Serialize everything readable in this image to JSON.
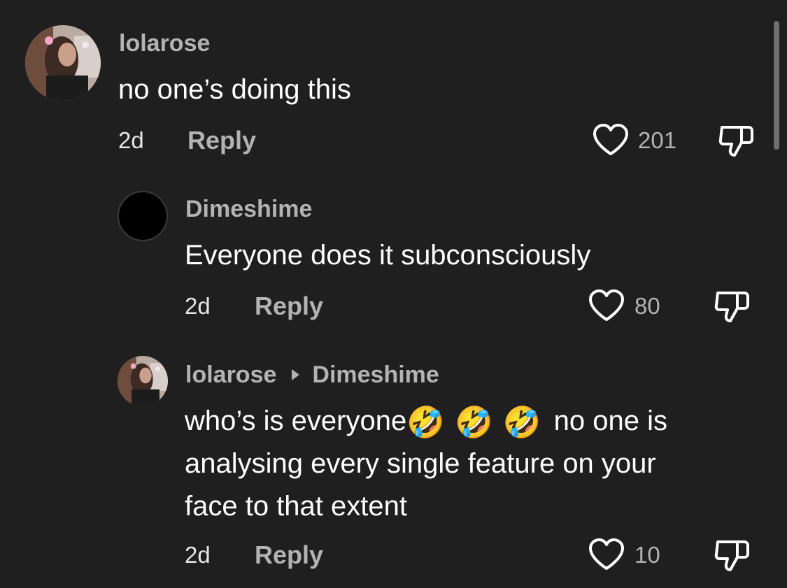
{
  "comments": [
    {
      "username": "lolarose",
      "text": "no one’s doing this",
      "time": "2d",
      "reply_label": "Reply",
      "likes": "201",
      "avatar": "photo-girl-icon"
    },
    {
      "username": "Dimeshime",
      "text": "Everyone does it subconsciously",
      "time": "2d",
      "reply_label": "Reply",
      "likes": "80",
      "avatar": "black-circle"
    },
    {
      "username": "lolarose",
      "reply_to": "Dimeshime",
      "text_line1_pre": "who’s is everyone",
      "emoji": "🤣",
      "text_line1_post": "no one is",
      "text_line2": "analysing every single feature on your",
      "text_line3": "face to that extent",
      "time": "2d",
      "reply_label": "Reply",
      "likes": "10",
      "avatar": "photo-girl-icon"
    }
  ],
  "colors": {
    "background": "#1f1f1f",
    "primary_text": "#ffffff",
    "secondary_text": "#b3b3b3"
  }
}
